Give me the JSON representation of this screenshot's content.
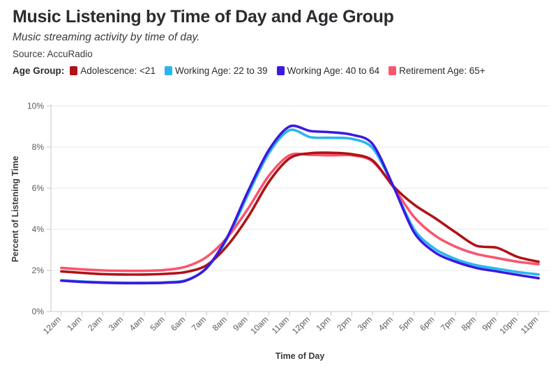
{
  "header": {
    "title": "Music Listening by Time of Day and Age Group",
    "subtitle": "Music streaming activity by time of day.",
    "source": "Source: AccuRadio"
  },
  "legend": {
    "title": "Age Group:",
    "items": [
      {
        "label": "Adolescence: <21",
        "color": "#b01217"
      },
      {
        "label": "Working Age: 22 to 39",
        "color": "#29b6f0"
      },
      {
        "label": "Working Age: 40 to 64",
        "color": "#3a1ae0"
      },
      {
        "label": "Retirement Age: 65+",
        "color": "#f9556f"
      }
    ]
  },
  "chart_data": {
    "type": "line",
    "title": "Music Listening by Time of Day and Age Group",
    "subtitle": "Music streaming activity by time of day.",
    "source": "Source: AccuRadio",
    "xlabel": "Time of Day",
    "ylabel": "Percent of Listening Time",
    "ylim": [
      0,
      10
    ],
    "yticks": [
      0,
      2,
      4,
      6,
      8,
      10
    ],
    "ytick_labels": [
      "0%",
      "2%",
      "4%",
      "6%",
      "8%",
      "10%"
    ],
    "grid": true,
    "legend_position": "top",
    "categories": [
      "12am",
      "1am",
      "2am",
      "3am",
      "4am",
      "5am",
      "6am",
      "7am",
      "8am",
      "9am",
      "10am",
      "11am",
      "12pm",
      "1pm",
      "2pm",
      "3pm",
      "4pm",
      "5pm",
      "6pm",
      "7pm",
      "8pm",
      "9pm",
      "10pm",
      "11pm"
    ],
    "series": [
      {
        "name": "Adolescence: <21",
        "color": "#b01217",
        "values": [
          1.95,
          1.88,
          1.82,
          1.8,
          1.8,
          1.83,
          1.92,
          2.25,
          3.2,
          4.6,
          6.3,
          7.45,
          7.7,
          7.72,
          7.65,
          7.35,
          6.1,
          5.2,
          4.55,
          3.85,
          3.2,
          3.1,
          2.65,
          2.42
        ]
      },
      {
        "name": "Working Age: 22 to 39",
        "color": "#29b6f0",
        "values": [
          1.52,
          1.46,
          1.42,
          1.4,
          1.4,
          1.42,
          1.52,
          2.1,
          3.55,
          5.7,
          7.7,
          8.82,
          8.48,
          8.45,
          8.4,
          7.95,
          6.1,
          4.0,
          3.05,
          2.55,
          2.25,
          2.08,
          1.92,
          1.8
        ]
      },
      {
        "name": "Working Age: 40 to 64",
        "color": "#3a1ae0",
        "values": [
          1.5,
          1.44,
          1.4,
          1.38,
          1.38,
          1.4,
          1.5,
          2.12,
          3.62,
          5.85,
          7.85,
          9.0,
          8.78,
          8.72,
          8.6,
          8.15,
          6.1,
          3.85,
          2.88,
          2.42,
          2.12,
          1.95,
          1.78,
          1.62
        ]
      },
      {
        "name": "Retirement Age: 65+",
        "color": "#f9556f",
        "values": [
          2.12,
          2.05,
          2.0,
          1.98,
          1.98,
          2.02,
          2.18,
          2.65,
          3.6,
          5.0,
          6.6,
          7.6,
          7.62,
          7.6,
          7.6,
          7.3,
          6.05,
          4.6,
          3.7,
          3.15,
          2.8,
          2.6,
          2.42,
          2.3
        ]
      }
    ]
  }
}
